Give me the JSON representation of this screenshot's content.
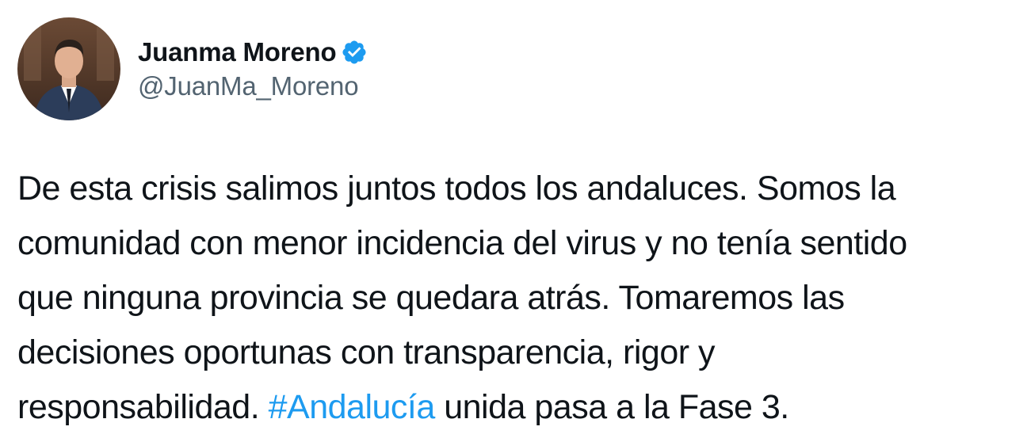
{
  "author": {
    "display_name": "Juanma Moreno",
    "handle": "@JuanMa_Moreno",
    "verified": true,
    "verified_icon": "verified-badge-icon",
    "badge_color": "#1d9bf0"
  },
  "tweet": {
    "lines": [
      {
        "text": "De esta crisis salimos juntos todos los andaluces. Somos la"
      },
      {
        "text": "comunidad con menor incidencia del virus y no tenía sentido"
      },
      {
        "text": "que ninguna provincia se quedara atrás. Tomaremos las"
      },
      {
        "text": "decisiones oportunas con transparencia, rigor y"
      },
      {
        "before": "responsabilidad. ",
        "hashtag": "#Andalucía",
        "after": " unida pasa a la Fase 3."
      }
    ]
  },
  "colors": {
    "text": "#0f1419",
    "secondary_text": "#536471",
    "link": "#1d9bf0",
    "background": "#ffffff"
  }
}
